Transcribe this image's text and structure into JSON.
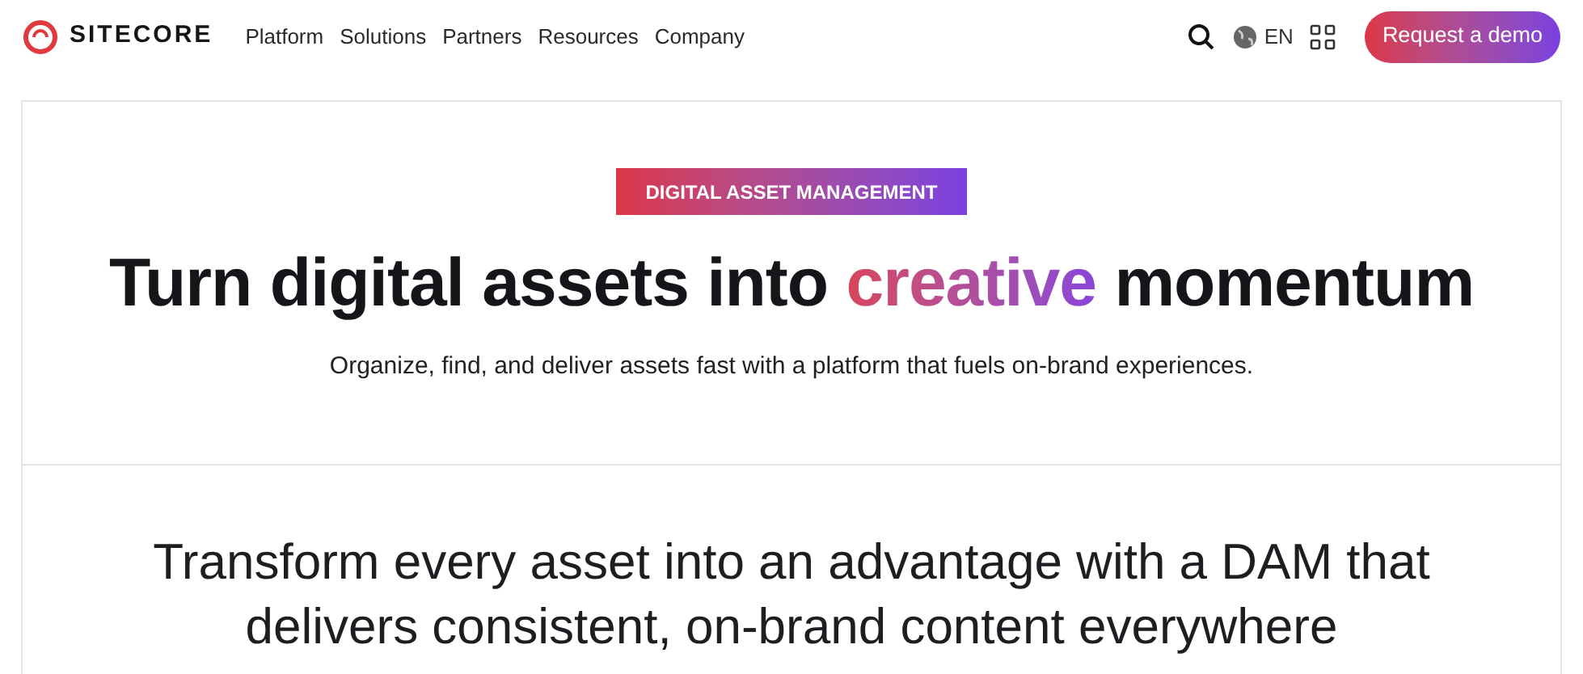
{
  "header": {
    "logo": "SITECORE",
    "nav": [
      "Platform",
      "Solutions",
      "Partners",
      "Resources",
      "Company"
    ],
    "language": "EN",
    "cta": "Request a demo"
  },
  "hero": {
    "tag": "DIGITAL ASSET MANAGEMENT",
    "headline": {
      "before": "Turn digital assets into ",
      "highlight": "creative",
      "after": " momentum"
    },
    "subtitle": "Organize, find, and deliver assets fast with a platform that fuels on-brand experiences."
  },
  "section": {
    "heading": "Transform every asset into an advantage with a DAM that delivers consistent, on-brand content everywhere"
  }
}
